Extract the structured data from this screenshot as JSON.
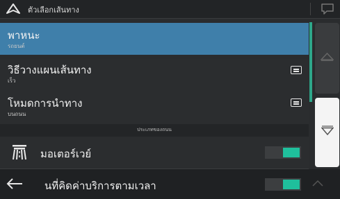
{
  "topbar": {
    "title": "ตัวเลือกเส้นทาง",
    "nav_icon": "navigation-arrow-icon",
    "message_icon": "speech-bubble-icon"
  },
  "rows": {
    "vehicle": {
      "label": "พาหนะ",
      "value": "รถยนต์"
    },
    "planning_method": {
      "label": "วิธีวางแผนเส้นทาง",
      "value": "เร็ว",
      "icon": "list-icon"
    },
    "navigation_mode": {
      "label": "โหมดการนำทาง",
      "value": "บนถนน",
      "icon": "list-icon"
    }
  },
  "section_header": "ประเภทของถนน",
  "road_types": {
    "motorway": {
      "label": "มอเตอร์เวย์",
      "icon": "motorway-icon",
      "enabled": true
    },
    "time_charged": {
      "label": "นที่คิดค่าบริการตามเวลา",
      "enabled": true
    }
  },
  "buttons": {
    "back_icon": "back-arrow-icon",
    "scroll_up_icon": "triangle-up-icon",
    "scroll_down_icon": "triangle-down-icon",
    "expand_icon": "chevron-up-icon"
  },
  "colors": {
    "selected_row": "#3f7faa",
    "toggle_on": "#1fbf9c",
    "background": "#2a2c2e"
  }
}
